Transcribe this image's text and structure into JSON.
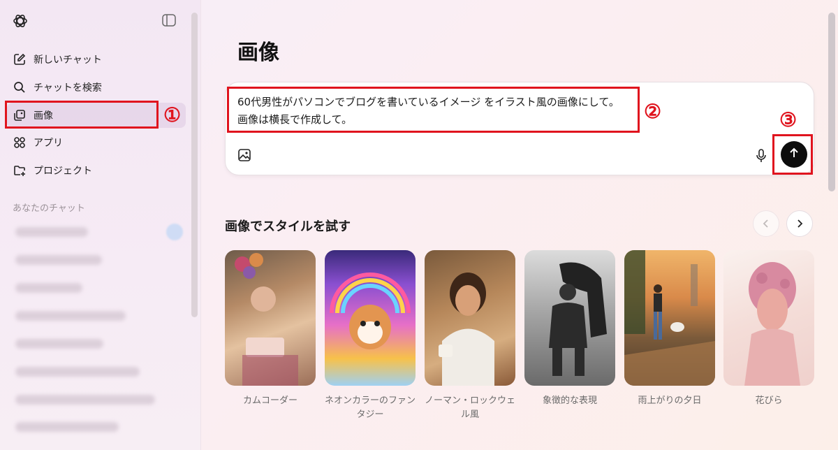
{
  "sidebar": {
    "items": [
      {
        "label": "新しいチャット"
      },
      {
        "label": "チャットを検索"
      },
      {
        "label": "画像"
      },
      {
        "label": "アプリ"
      },
      {
        "label": "プロジェクト"
      }
    ],
    "chats_section_label": "あなたのチャット"
  },
  "main": {
    "title": "画像",
    "composer": {
      "line1": "60代男性がパソコンでブログを書いているイメージ をイラスト風の画像にして。",
      "line2": "画像は横長で作成して。"
    },
    "styles_title": "画像でスタイルを試す",
    "styles": [
      {
        "label": "カムコーダー"
      },
      {
        "label": "ネオンカラーのファンタジー"
      },
      {
        "label": "ノーマン・ロックウェル風"
      },
      {
        "label": "象徴的な表現"
      },
      {
        "label": "雨上がりの夕日"
      },
      {
        "label": "花びら"
      }
    ]
  },
  "annotations": {
    "n1": "①",
    "n2": "②",
    "n3": "③"
  },
  "colors": {
    "accent_annotation": "#e0141e",
    "send_button": "#0d0d0d"
  },
  "icons": [
    "openai-logo-icon",
    "sidebar-toggle-icon",
    "compose-icon",
    "search-icon",
    "images-icon",
    "apps-icon",
    "folder-plus-icon",
    "image-upload-icon",
    "microphone-icon",
    "arrow-up-icon",
    "chevron-left-icon",
    "chevron-right-icon"
  ]
}
